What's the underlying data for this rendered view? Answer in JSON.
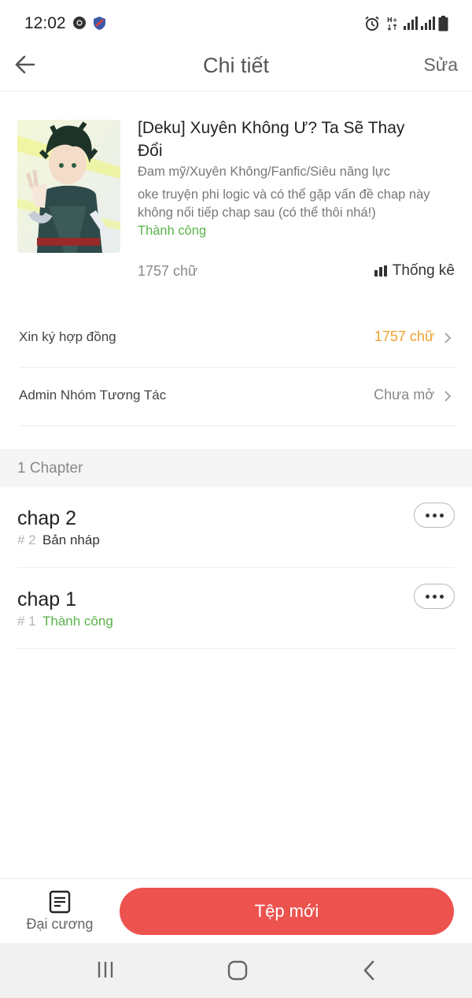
{
  "status_bar": {
    "time": "12:02"
  },
  "header": {
    "title": "Chi tiết",
    "edit_label": "Sửa"
  },
  "book": {
    "title": "[Deku] Xuyên Không Ư? Ta Sẽ Thay Đổi",
    "genres": "Đam mỹ/Xuyên Không/Fanfic/Siêu năng lực",
    "description": "oke truyện phi logic và có thể gặp vấn đề chap này không nối tiếp chap sau (có thể thôi nhá!)",
    "status": "Thành công",
    "word_count": "1757 chữ",
    "stats_label": "Thống kê"
  },
  "rows": [
    {
      "label": "Xin ký hợp đồng",
      "value": "1757 chữ",
      "color": "#f0a030"
    },
    {
      "label": "Admin Nhóm Tương Tác",
      "value": "Chưa mở",
      "color": "#888888"
    }
  ],
  "section": {
    "label": "1 Chapter"
  },
  "chapters": [
    {
      "title": "chap 2",
      "number": "# 2",
      "status": "Bản nháp",
      "status_color": "#333333"
    },
    {
      "title": "chap 1",
      "number": "# 1",
      "status": "Thành công",
      "status_color": "#59b34a"
    }
  ],
  "bottom": {
    "outline_label": "Đại cương",
    "new_file_label": "Tệp mới"
  },
  "colors": {
    "accent": "#ec534f",
    "success": "#59b34a",
    "warning": "#f0a030"
  }
}
